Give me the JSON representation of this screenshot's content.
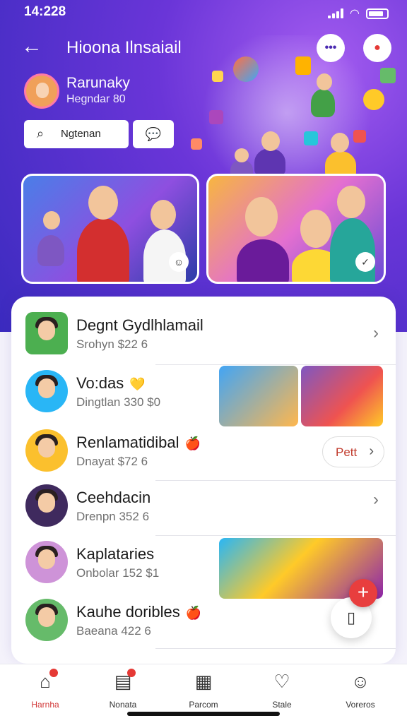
{
  "status_bar": {
    "time": "14:228"
  },
  "header": {
    "title": "Hioona Ilnsaiail",
    "more_glyph": "•••",
    "back_icon": "arrow-left-icon",
    "spark_icon": "balloon-icon"
  },
  "profile": {
    "name": "Rarunaky",
    "subtitle": "Hegndar 80"
  },
  "search_chip": {
    "label": "Ngtenan",
    "icon": "search-icon"
  },
  "chat_chip": {
    "icon": "chat-icon"
  },
  "list": [
    {
      "name": "Degnt Gydlhlamail",
      "sub": "Srohyn  $22  6",
      "emoji": "",
      "accent": "#4caf50",
      "trailing": "chevron"
    },
    {
      "name": "Vo:das",
      "sub": "Dingtlan  330  $0",
      "emoji": "💛",
      "accent": "#29b6f6",
      "trailing": "thumbs"
    },
    {
      "name": "Renlamatidibal",
      "sub": "Dnayat  $72  6",
      "emoji": "🍎",
      "accent": "#fbc02d",
      "trailing": "pill"
    },
    {
      "name": "Ceehdacin",
      "sub": "Drenpn  352  6",
      "emoji": "",
      "accent": "#3f2a5e",
      "trailing": "chevron"
    },
    {
      "name": "Kaplataries",
      "sub": "Onbolar  152  $1",
      "emoji": "",
      "accent": "#ce93d8",
      "trailing": "thumb"
    },
    {
      "name": "Kauhe doribles",
      "sub": "Baeana  422  6",
      "emoji": "🍎",
      "accent": "#66bb6a",
      "trailing": ""
    }
  ],
  "pill": {
    "label": "Pett",
    "chevron": "›"
  },
  "fab": {
    "plus": "+",
    "icon": "tablet-icon"
  },
  "tabs": [
    {
      "label": "Harnha",
      "icon": "home-icon",
      "active": true
    },
    {
      "label": "Nonata",
      "icon": "notes-icon",
      "active": false
    },
    {
      "label": "Parcom",
      "icon": "calendar-icon",
      "active": false
    },
    {
      "label": "Stale",
      "icon": "heart-icon",
      "active": false
    },
    {
      "label": "Voreros",
      "icon": "person-icon",
      "active": false
    }
  ],
  "colors": {
    "accent": "#5a34d4",
    "danger": "#e53935"
  }
}
